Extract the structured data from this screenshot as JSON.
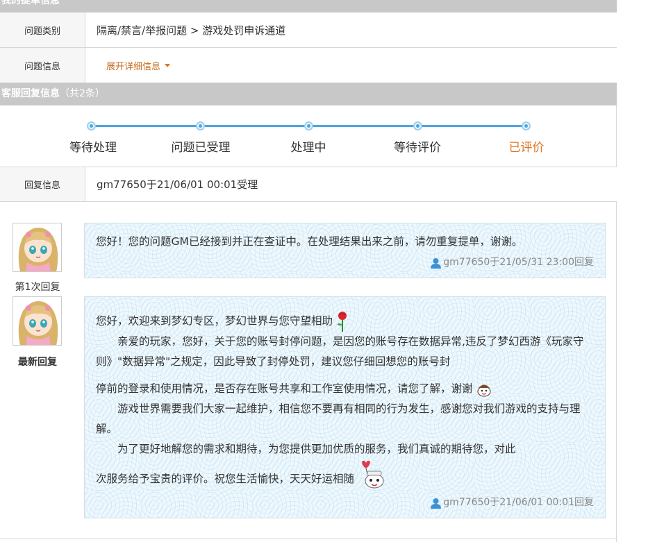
{
  "top_bar": {
    "title": "我的提单信息"
  },
  "ticket": {
    "category_label": "问题类别",
    "category_value": "隔离/禁言/举报问题 > 游戏处罚申诉通道",
    "info_label": "问题信息",
    "expand_label": "展开详细信息"
  },
  "reply_bar": {
    "title": "客服回复信息",
    "count": "（共2条）"
  },
  "steps": {
    "items": [
      "等待处理",
      "问题已受理",
      "处理中",
      "等待评价",
      "已评价"
    ],
    "active_index": 4
  },
  "reply_info": {
    "label": "回复信息",
    "value": "gm77650于21/06/01 00:01受理"
  },
  "replies": [
    {
      "avatar_label": "第1次回复",
      "lines": [
        "您好！您的问题GM已经接到并正在查证中。在处理结果出来之前，请勿重复提单，谢谢。"
      ],
      "signature": "gm77650于21/05/31 23:00回复"
    },
    {
      "avatar_label": "最新回复",
      "p1": "您好，欢迎来到梦幻专区，梦幻世界与您守望相助",
      "p2": "亲爱的玩家，您好，关于您的账号封停问题，是因您的账号存在数据异常,违反了梦幻西游《玩家守则》\"数据异常\"之规定，因此导致了封停处罚，建议您仔细回想您的账号封",
      "p3": "停前的登录和使用情况，是否存在账号共享和工作室使用情况，请您了解，谢谢",
      "p4": "游戏世界需要我们大家一起维护，相信您不要再有相同的行为发生，感谢您对我们游戏的支持与理解。",
      "p5": "为了更好地解您的需求和期待，为您提供更加优质的服务，我们真诚的期待您，对此",
      "p6": "次服务给予宝贵的评价。祝您生活愉快，天天好运相随",
      "signature": "gm77650于21/06/01 00:01回复"
    }
  ],
  "colors": {
    "accent_orange": "#e0731d",
    "progress_blue": "#4da6dd",
    "bar_gray": "#c8c8c8"
  }
}
